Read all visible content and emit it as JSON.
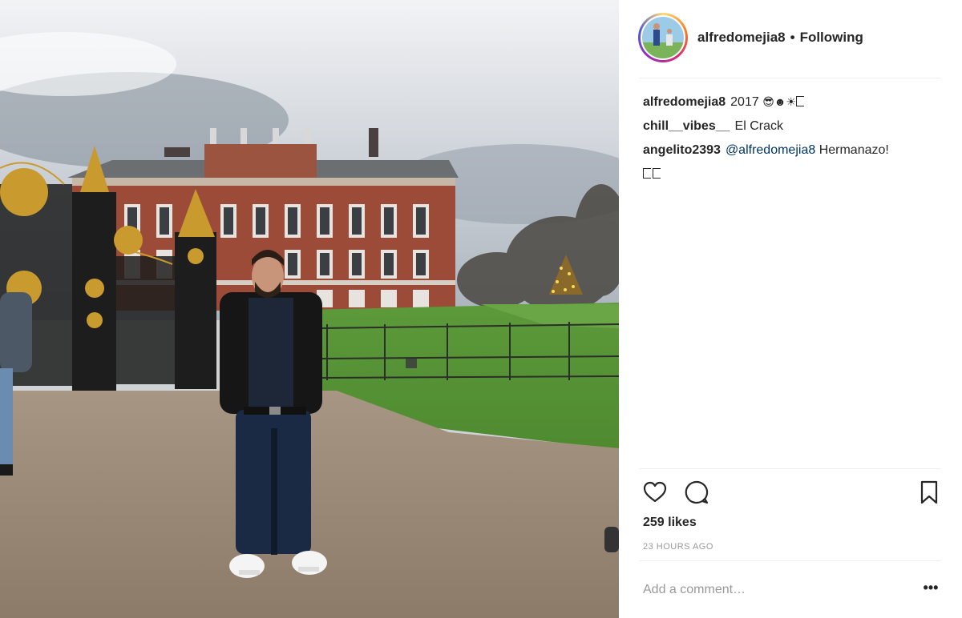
{
  "post": {
    "username": "alfredomejia8",
    "separator": "•",
    "follow_status": "Following"
  },
  "comments": [
    {
      "user": "alfredomejia8",
      "text": "2017",
      "emoji": "😎☻☀"
    },
    {
      "user": "chill__vibes__",
      "text": "El Crack"
    },
    {
      "user": "angelito2393",
      "mention": "@alfredomejia8",
      "text": "Hermanazo!"
    }
  ],
  "actions": {
    "like_icon": "heart-icon",
    "comment_icon": "comment-icon",
    "save_icon": "bookmark-icon"
  },
  "likes": "259 likes",
  "timestamp": "23 HOURS AGO",
  "add_comment": {
    "placeholder": "Add a comment…"
  },
  "more_options": "•••",
  "colors": {
    "link": "#003569",
    "muted": "#999999",
    "text": "#262626"
  }
}
